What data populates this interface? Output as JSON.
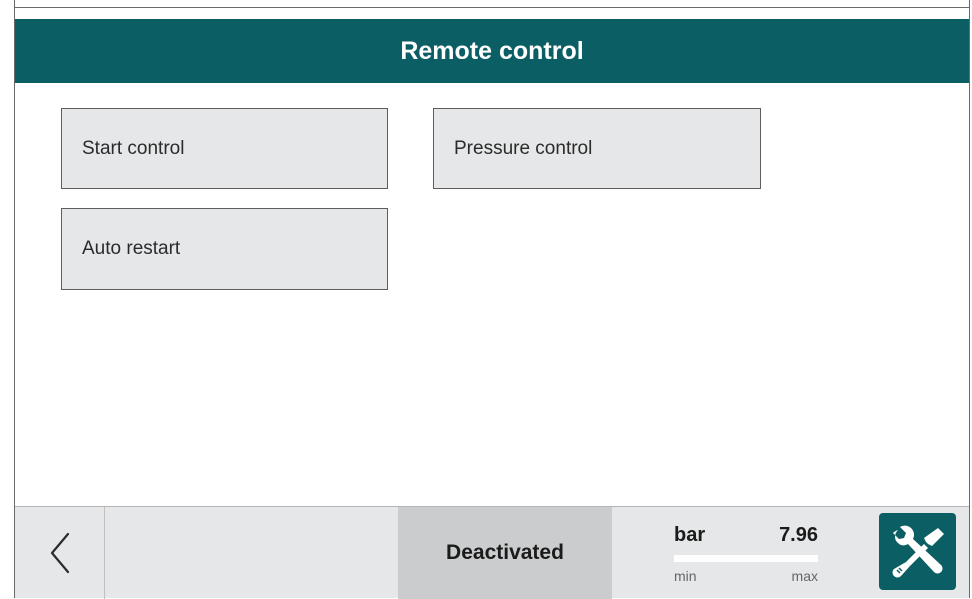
{
  "header": {
    "title": "Remote control"
  },
  "menu": {
    "items": [
      {
        "label": "Start control"
      },
      {
        "label": "Pressure control"
      },
      {
        "label": "Auto restart"
      }
    ]
  },
  "footer": {
    "back_icon": "chevron-left-icon",
    "status": "Deactivated",
    "gauge": {
      "unit": "bar",
      "value": "7.96",
      "min_label": "min",
      "max_label": "max",
      "level_fraction": 1.0
    },
    "tools_icon": "wrench-screwdriver-icon"
  },
  "colors": {
    "accent": "#0b5e63",
    "tile_bg": "#e6e7e8",
    "footer_bg": "#e6e7e8",
    "status_bg": "#cbcccd"
  }
}
